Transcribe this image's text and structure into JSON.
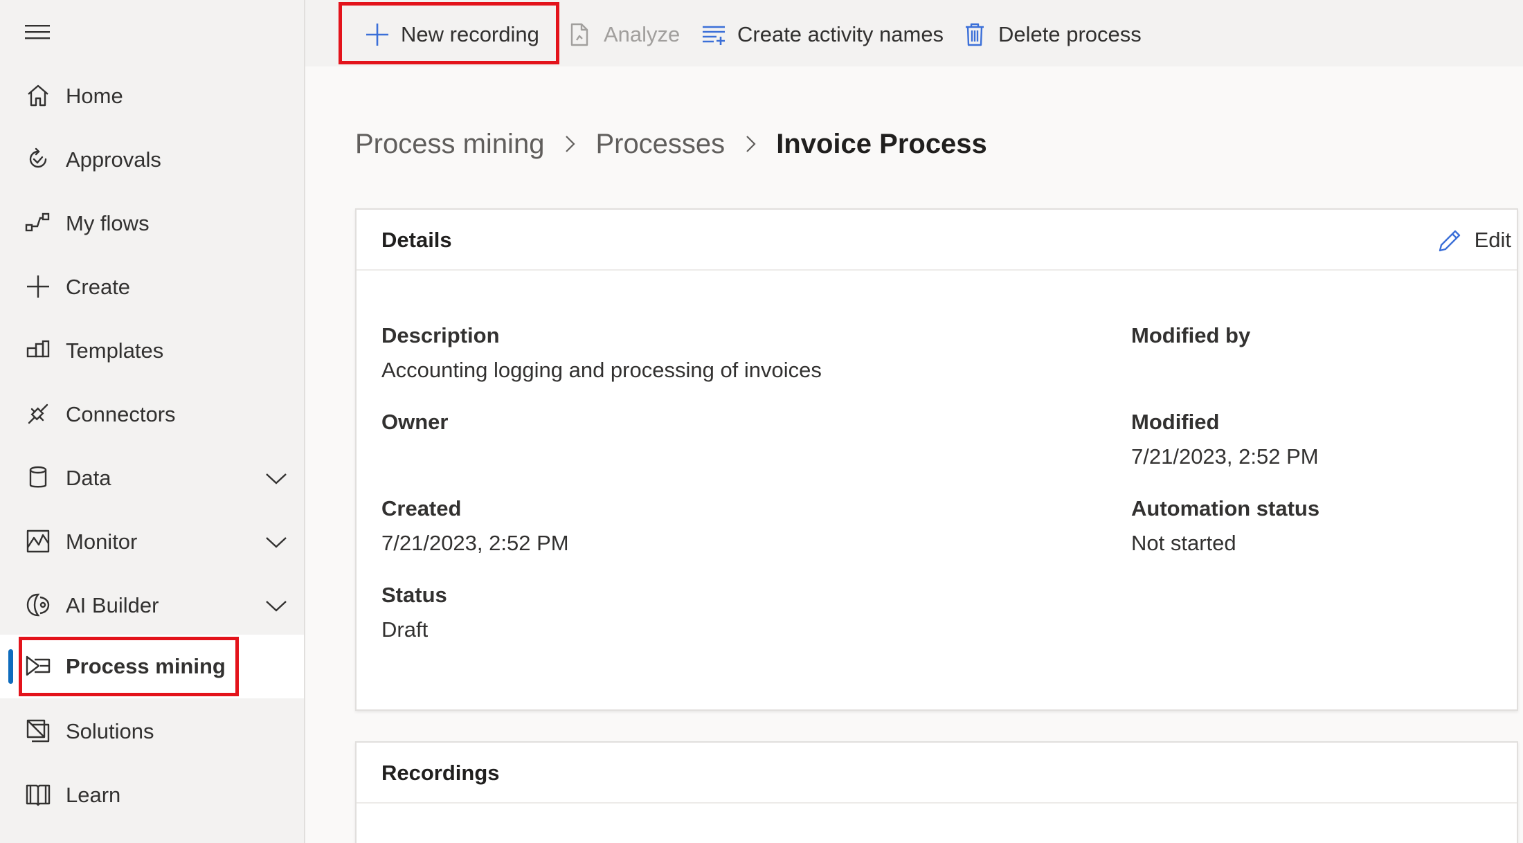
{
  "sidebar": {
    "items": [
      {
        "label": "Home",
        "icon": "home-icon"
      },
      {
        "label": "Approvals",
        "icon": "approvals-icon"
      },
      {
        "label": "My flows",
        "icon": "flows-icon"
      },
      {
        "label": "Create",
        "icon": "plus-icon"
      },
      {
        "label": "Templates",
        "icon": "templates-icon"
      },
      {
        "label": "Connectors",
        "icon": "connectors-icon"
      },
      {
        "label": "Data",
        "icon": "database-icon",
        "expandable": true
      },
      {
        "label": "Monitor",
        "icon": "monitor-icon",
        "expandable": true
      },
      {
        "label": "AI Builder",
        "icon": "ai-builder-icon",
        "expandable": true
      },
      {
        "label": "Process mining",
        "icon": "process-mining-icon",
        "selected": true
      },
      {
        "label": "Solutions",
        "icon": "solutions-icon"
      },
      {
        "label": "Learn",
        "icon": "book-icon"
      }
    ]
  },
  "toolbar": {
    "new_recording": "New recording",
    "analyze": "Analyze",
    "create_activity_names": "Create activity names",
    "delete_process": "Delete process"
  },
  "breadcrumb": {
    "root": "Process mining",
    "parent": "Processes",
    "current": "Invoice Process"
  },
  "details": {
    "title": "Details",
    "edit_label": "Edit",
    "description_label": "Description",
    "description_value": "Accounting logging and processing of invoices",
    "owner_label": "Owner",
    "owner_value": "",
    "created_label": "Created",
    "created_value": "7/21/2023, 2:52 PM",
    "status_label": "Status",
    "status_value": "Draft",
    "modified_by_label": "Modified by",
    "modified_by_value": "",
    "modified_label": "Modified",
    "modified_value": "7/21/2023, 2:52 PM",
    "automation_status_label": "Automation status",
    "automation_status_value": "Not started"
  },
  "recordings": {
    "title": "Recordings"
  },
  "colors": {
    "accent": "#0f6cbd",
    "icon_blue": "#3b6fd8",
    "highlight_red": "#e3131b",
    "sidebar_bg": "#f3f2f1",
    "disabled_text": "#a19f9d"
  }
}
